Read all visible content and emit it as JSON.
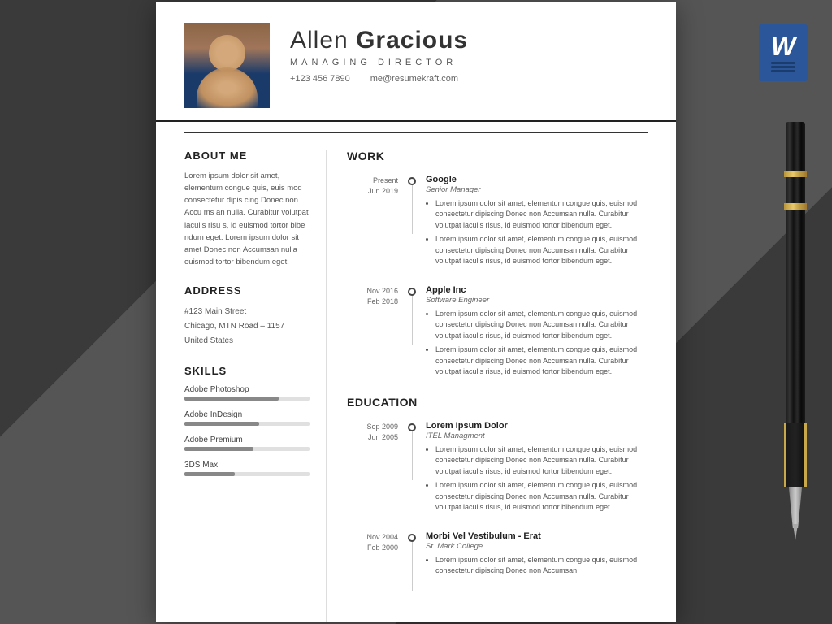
{
  "background": "#555555",
  "resume": {
    "header": {
      "name_first": "Allen",
      "name_last": "Gracious",
      "title": "MANAGING DIRECTOR",
      "phone": "+123 456 7890",
      "email": "me@resumekraft.com"
    },
    "left": {
      "about_title": "ABOUT ME",
      "about_text": "Lorem ipsum dolor sit amet, elementum congue quis, euis mod  consectetur dipis cing Donec non Accu ms an nulla. Curabitur volutpat iaculis risu s, id euismod tortor bibe ndum eget. Lorem ipsum dolor sit amet Donec non Accumsan nulla euismod tortor bibendum eget.",
      "address_title": "ADDRESS",
      "address_line1": "#123 Main Street",
      "address_line2": "Chicago, MTN Road – 1157",
      "address_line3": "United States",
      "skills_title": "SKILLS",
      "skills": [
        {
          "name": "Adobe Photoshop",
          "percent": 75
        },
        {
          "name": "Adobe InDesign",
          "percent": 60
        },
        {
          "name": "Adobe Premium",
          "percent": 55
        },
        {
          "name": "3DS Max",
          "percent": 40
        }
      ]
    },
    "right": {
      "work_title": "WORK",
      "work_entries": [
        {
          "date_from": "Jun 2019",
          "date_to": "Present",
          "company": "Google",
          "role": "Senior Manager",
          "bullets": [
            "Lorem ipsum dolor sit amet, elementum congue quis, euismod  consectetur dipiscing Donec non Accumsan nulla. Curabitur volutpat iaculis risus, id euismod tortor bibendum eget.",
            "Lorem ipsum dolor sit amet, elementum congue quis, euismod  consectetur dipiscing Donec non Accumsan nulla. Curabitur volutpat iaculis risus, id euismod tortor bibendum eget."
          ]
        },
        {
          "date_from": "Feb 2018",
          "date_to": "Nov 2016",
          "company": "Apple Inc",
          "role": "Software Engineer",
          "bullets": [
            "Lorem ipsum dolor sit amet, elementum congue quis, euismod  consectetur dipiscing Donec non Accumsan nulla. Curabitur volutpat iaculis risus, id euismod tortor bibendum eget.",
            "Lorem ipsum dolor sit amet, elementum congue quis, euismod  consectetur dipiscing Donec non Accumsan nulla. Curabitur volutpat iaculis risus, id euismod tortor bibendum eget."
          ]
        }
      ],
      "education_title": "EDUCATION",
      "education_entries": [
        {
          "date_from": "Jun 2005",
          "date_to": "Sep 2009",
          "institution": "Lorem Ipsum Dolor",
          "field": "ITEL Managment",
          "bullets": [
            "Lorem ipsum dolor sit amet, elementum congue quis, euismod  consectetur dipiscing Donec non Accumsan nulla. Curabitur volutpat iaculis risus, id euismod tortor bibendum eget.",
            "Lorem ipsum dolor sit amet, elementum congue quis, euismod  consectetur dipiscing Donec non Accumsan nulla. Curabitur volutpat iaculis risus, id euismod tortor bibendum eget."
          ]
        },
        {
          "date_from": "Feb 2000",
          "date_to": "Nov 2004",
          "institution": "Morbi Vel Vestibulum - Erat",
          "field": "St. Mark College",
          "bullets": [
            "Lorem ipsum dolor sit amet, elementum congue quis, euismod  consectetur dipiscing Donec non Accumsan"
          ]
        }
      ]
    }
  },
  "word_icon": {
    "letter": "W",
    "label": "Microsoft Word"
  }
}
